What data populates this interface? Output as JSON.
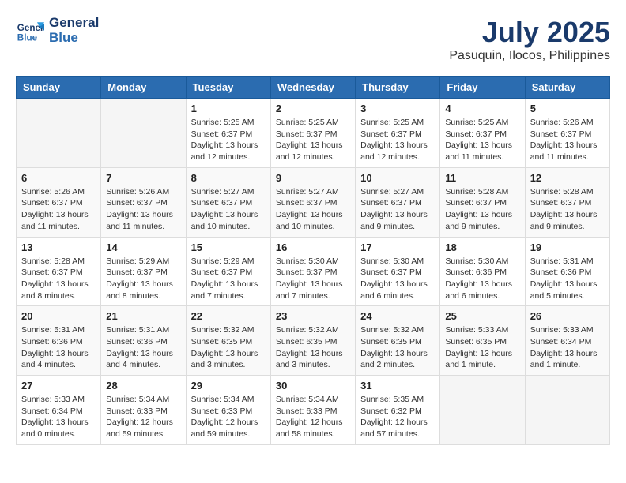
{
  "header": {
    "logo_line1": "General",
    "logo_line2": "Blue",
    "month": "July 2025",
    "location": "Pasuquin, Ilocos, Philippines"
  },
  "columns": [
    "Sunday",
    "Monday",
    "Tuesday",
    "Wednesday",
    "Thursday",
    "Friday",
    "Saturday"
  ],
  "weeks": [
    [
      {
        "day": "",
        "empty": true
      },
      {
        "day": "",
        "empty": true
      },
      {
        "day": "1",
        "sunrise": "Sunrise: 5:25 AM",
        "sunset": "Sunset: 6:37 PM",
        "daylight": "Daylight: 13 hours and 12 minutes."
      },
      {
        "day": "2",
        "sunrise": "Sunrise: 5:25 AM",
        "sunset": "Sunset: 6:37 PM",
        "daylight": "Daylight: 13 hours and 12 minutes."
      },
      {
        "day": "3",
        "sunrise": "Sunrise: 5:25 AM",
        "sunset": "Sunset: 6:37 PM",
        "daylight": "Daylight: 13 hours and 12 minutes."
      },
      {
        "day": "4",
        "sunrise": "Sunrise: 5:25 AM",
        "sunset": "Sunset: 6:37 PM",
        "daylight": "Daylight: 13 hours and 11 minutes."
      },
      {
        "day": "5",
        "sunrise": "Sunrise: 5:26 AM",
        "sunset": "Sunset: 6:37 PM",
        "daylight": "Daylight: 13 hours and 11 minutes."
      }
    ],
    [
      {
        "day": "6",
        "sunrise": "Sunrise: 5:26 AM",
        "sunset": "Sunset: 6:37 PM",
        "daylight": "Daylight: 13 hours and 11 minutes."
      },
      {
        "day": "7",
        "sunrise": "Sunrise: 5:26 AM",
        "sunset": "Sunset: 6:37 PM",
        "daylight": "Daylight: 13 hours and 11 minutes."
      },
      {
        "day": "8",
        "sunrise": "Sunrise: 5:27 AM",
        "sunset": "Sunset: 6:37 PM",
        "daylight": "Daylight: 13 hours and 10 minutes."
      },
      {
        "day": "9",
        "sunrise": "Sunrise: 5:27 AM",
        "sunset": "Sunset: 6:37 PM",
        "daylight": "Daylight: 13 hours and 10 minutes."
      },
      {
        "day": "10",
        "sunrise": "Sunrise: 5:27 AM",
        "sunset": "Sunset: 6:37 PM",
        "daylight": "Daylight: 13 hours and 9 minutes."
      },
      {
        "day": "11",
        "sunrise": "Sunrise: 5:28 AM",
        "sunset": "Sunset: 6:37 PM",
        "daylight": "Daylight: 13 hours and 9 minutes."
      },
      {
        "day": "12",
        "sunrise": "Sunrise: 5:28 AM",
        "sunset": "Sunset: 6:37 PM",
        "daylight": "Daylight: 13 hours and 9 minutes."
      }
    ],
    [
      {
        "day": "13",
        "sunrise": "Sunrise: 5:28 AM",
        "sunset": "Sunset: 6:37 PM",
        "daylight": "Daylight: 13 hours and 8 minutes."
      },
      {
        "day": "14",
        "sunrise": "Sunrise: 5:29 AM",
        "sunset": "Sunset: 6:37 PM",
        "daylight": "Daylight: 13 hours and 8 minutes."
      },
      {
        "day": "15",
        "sunrise": "Sunrise: 5:29 AM",
        "sunset": "Sunset: 6:37 PM",
        "daylight": "Daylight: 13 hours and 7 minutes."
      },
      {
        "day": "16",
        "sunrise": "Sunrise: 5:30 AM",
        "sunset": "Sunset: 6:37 PM",
        "daylight": "Daylight: 13 hours and 7 minutes."
      },
      {
        "day": "17",
        "sunrise": "Sunrise: 5:30 AM",
        "sunset": "Sunset: 6:37 PM",
        "daylight": "Daylight: 13 hours and 6 minutes."
      },
      {
        "day": "18",
        "sunrise": "Sunrise: 5:30 AM",
        "sunset": "Sunset: 6:36 PM",
        "daylight": "Daylight: 13 hours and 6 minutes."
      },
      {
        "day": "19",
        "sunrise": "Sunrise: 5:31 AM",
        "sunset": "Sunset: 6:36 PM",
        "daylight": "Daylight: 13 hours and 5 minutes."
      }
    ],
    [
      {
        "day": "20",
        "sunrise": "Sunrise: 5:31 AM",
        "sunset": "Sunset: 6:36 PM",
        "daylight": "Daylight: 13 hours and 4 minutes."
      },
      {
        "day": "21",
        "sunrise": "Sunrise: 5:31 AM",
        "sunset": "Sunset: 6:36 PM",
        "daylight": "Daylight: 13 hours and 4 minutes."
      },
      {
        "day": "22",
        "sunrise": "Sunrise: 5:32 AM",
        "sunset": "Sunset: 6:35 PM",
        "daylight": "Daylight: 13 hours and 3 minutes."
      },
      {
        "day": "23",
        "sunrise": "Sunrise: 5:32 AM",
        "sunset": "Sunset: 6:35 PM",
        "daylight": "Daylight: 13 hours and 3 minutes."
      },
      {
        "day": "24",
        "sunrise": "Sunrise: 5:32 AM",
        "sunset": "Sunset: 6:35 PM",
        "daylight": "Daylight: 13 hours and 2 minutes."
      },
      {
        "day": "25",
        "sunrise": "Sunrise: 5:33 AM",
        "sunset": "Sunset: 6:35 PM",
        "daylight": "Daylight: 13 hours and 1 minute."
      },
      {
        "day": "26",
        "sunrise": "Sunrise: 5:33 AM",
        "sunset": "Sunset: 6:34 PM",
        "daylight": "Daylight: 13 hours and 1 minute."
      }
    ],
    [
      {
        "day": "27",
        "sunrise": "Sunrise: 5:33 AM",
        "sunset": "Sunset: 6:34 PM",
        "daylight": "Daylight: 13 hours and 0 minutes."
      },
      {
        "day": "28",
        "sunrise": "Sunrise: 5:34 AM",
        "sunset": "Sunset: 6:33 PM",
        "daylight": "Daylight: 12 hours and 59 minutes."
      },
      {
        "day": "29",
        "sunrise": "Sunrise: 5:34 AM",
        "sunset": "Sunset: 6:33 PM",
        "daylight": "Daylight: 12 hours and 59 minutes."
      },
      {
        "day": "30",
        "sunrise": "Sunrise: 5:34 AM",
        "sunset": "Sunset: 6:33 PM",
        "daylight": "Daylight: 12 hours and 58 minutes."
      },
      {
        "day": "31",
        "sunrise": "Sunrise: 5:35 AM",
        "sunset": "Sunset: 6:32 PM",
        "daylight": "Daylight: 12 hours and 57 minutes."
      },
      {
        "day": "",
        "empty": true
      },
      {
        "day": "",
        "empty": true
      }
    ]
  ]
}
